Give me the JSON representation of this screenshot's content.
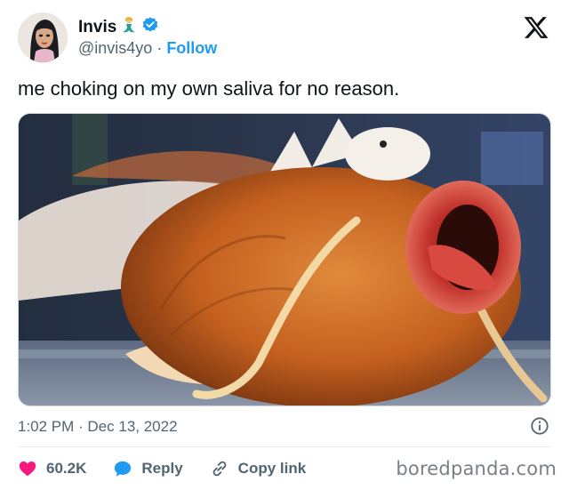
{
  "tweet": {
    "author_name": "Invis",
    "handle": "@invis4yo",
    "separator": " · ",
    "follow_label": "Follow",
    "text": "me choking on my own saliva for no reason.",
    "timestamp": "1:02 PM · Dec 13, 2022",
    "like_count": "60.2K",
    "reply_label": "Reply",
    "copy_link_label": "Copy link"
  },
  "source_watermark": "boredpanda.com",
  "icons": {
    "verified": "verified-badge-icon",
    "emoji": "mermaid-emoji-icon",
    "platform": "x-logo-icon",
    "info": "info-icon",
    "like": "heart-icon",
    "reply": "reply-bubble-icon",
    "copy": "link-icon"
  },
  "colors": {
    "accent": "#1d9bf0",
    "like": "#f91880",
    "text": "#0f1419",
    "muted": "#536471"
  }
}
